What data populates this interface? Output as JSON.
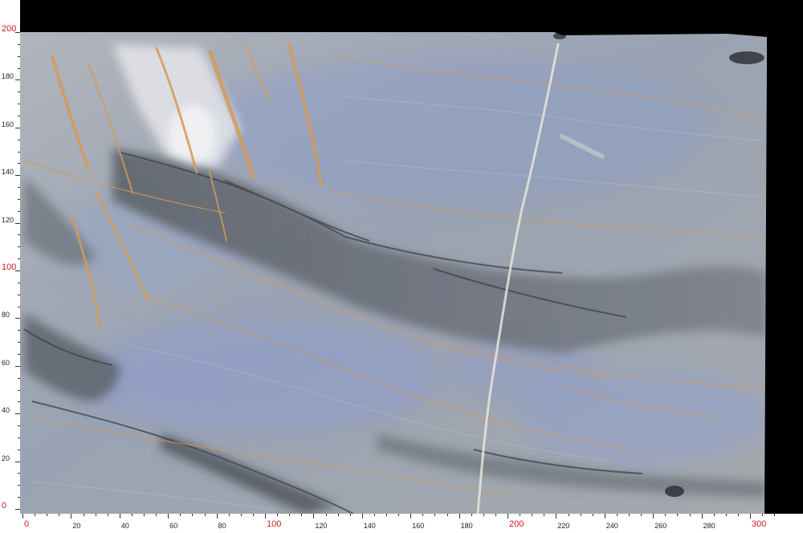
{
  "image": {
    "subject": "",
    "colors": {
      "background": "#000000",
      "stone_base": "#a4a9b2",
      "stone_blue": "#8d9ec4",
      "stone_gray": "#7b8088",
      "stone_dark": "#4a4f56",
      "vein_gold": "#d49a5a",
      "vein_light": "#efe9df",
      "ruler_bg": "#ffffff",
      "ruler_major": "#cc1b1b",
      "ruler_minor": "#222222"
    }
  },
  "ruler": {
    "x_labels": [
      "0",
      "20",
      "40",
      "60",
      "80",
      "100",
      "120",
      "140",
      "160",
      "180",
      "200",
      "220",
      "240",
      "260",
      "280",
      "300"
    ],
    "x_major": [
      "0",
      "100",
      "200",
      "300"
    ],
    "y_labels": [
      "0",
      "20",
      "40",
      "60",
      "80",
      "100",
      "120",
      "140",
      "160",
      "180",
      "200"
    ],
    "y_major": [
      "0",
      "100",
      "200"
    ],
    "x_max": 310,
    "y_max": 200
  }
}
